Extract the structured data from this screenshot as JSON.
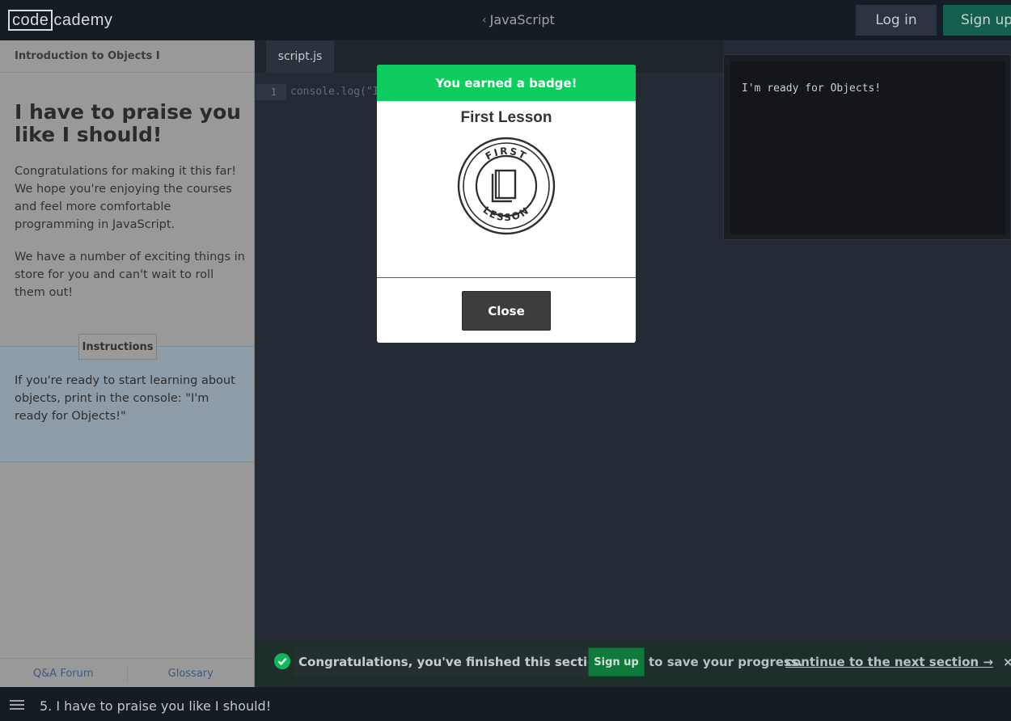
{
  "header": {
    "logo_boxed": "code",
    "logo_rest": "cademy",
    "course": "JavaScript",
    "login": "Log in",
    "signup": "Sign up"
  },
  "lesson": {
    "unit": "Introduction to Objects I",
    "title": "I have to praise you like I should!",
    "paragraphs": [
      "Congratulations for making it this far! We hope you're enjoying the courses and feel more comfortable programming in JavaScript.",
      "We have a number of exciting things in store for you and can't wait to roll them out!"
    ],
    "instructions_tab": "Instructions",
    "instructions": "If you're ready to start learning about objects, print in the console: \"I'm ready for Objects!\"",
    "footer_links": [
      "Q&A Forum",
      "Glossary"
    ]
  },
  "editor": {
    "tab": "script.js",
    "line_number": "1",
    "code": "console.log(\"I"
  },
  "console": {
    "output": "I'm ready for Objects!"
  },
  "modal": {
    "header": "You earned a badge!",
    "badge_name": "First Lesson",
    "badge_top_text": "FIRST",
    "badge_bottom_text": "LESSON",
    "close": "Close"
  },
  "congrats": {
    "message": "Congratulations, you've finished this section!",
    "signup": "Sign up",
    "save_text": "to save your progress.",
    "next_link": "continue to the next section →",
    "close_glyph": "×"
  },
  "footer": {
    "title": "5. I have to praise you like I should!"
  },
  "colors": {
    "accent_green": "#0fcc5f",
    "background": "#252b35",
    "topbar": "#141c24"
  }
}
